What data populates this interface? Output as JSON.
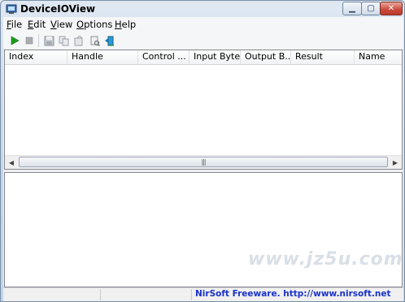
{
  "window": {
    "title": "DeviceIOView",
    "controls": [
      "minimize",
      "maximize",
      "close"
    ]
  },
  "menu": [
    {
      "key": "F",
      "rest": "ile"
    },
    {
      "key": "E",
      "rest": "dit"
    },
    {
      "key": "V",
      "rest": "iew"
    },
    {
      "key": "O",
      "rest": "ptions"
    },
    {
      "key": "H",
      "rest": "elp"
    }
  ],
  "toolbar": {
    "icons": [
      "start-icon",
      "stop-icon",
      "save-icon",
      "copy-icon",
      "html-report-icon",
      "properties-icon",
      "exit-icon"
    ]
  },
  "table": {
    "columns": [
      "Index",
      "Handle",
      "Control ...",
      "Input Bytes",
      "Output B...",
      "Result",
      "Name"
    ],
    "rows": []
  },
  "statusbar": {
    "text": "NirSoft Freeware.  http://www.nirsoft.net"
  },
  "watermark": "www.jz5u.com",
  "colors": {
    "start_green": "#1a9e1a",
    "status_link": "#1a32c8",
    "close_red": "#c9483a"
  }
}
